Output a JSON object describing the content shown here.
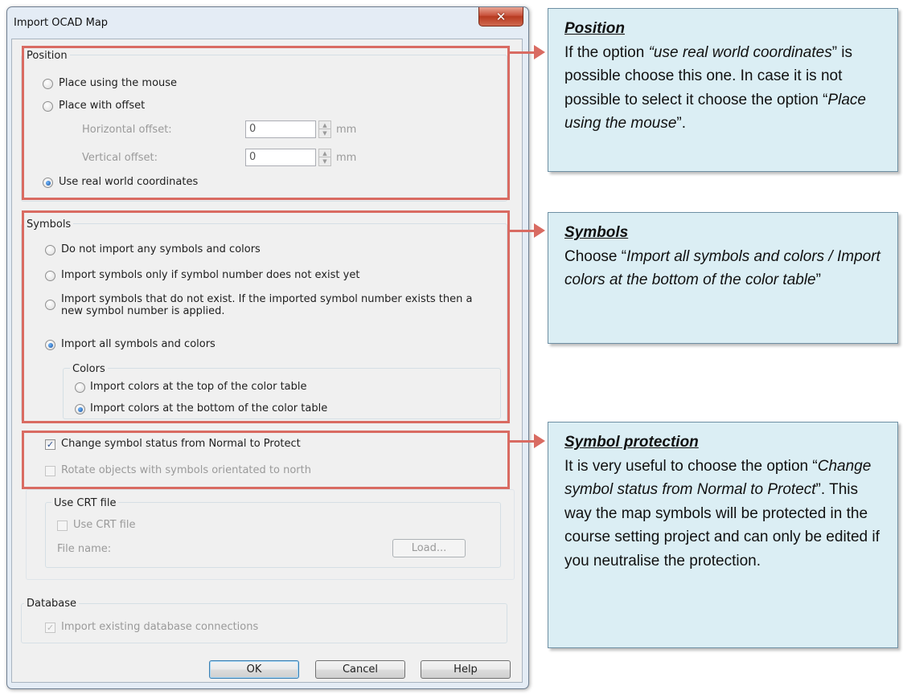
{
  "dialog": {
    "title": "Import OCAD Map",
    "close_glyph": "✕"
  },
  "position": {
    "group_label": "Position",
    "place_mouse": "Place using the mouse",
    "place_offset": "Place with offset",
    "horizontal_label": "Horizontal offset:",
    "horizontal_value": "0",
    "horizontal_unit": "mm",
    "vertical_label": "Vertical offset:",
    "vertical_value": "0",
    "vertical_unit": "mm",
    "real_world": "Use real world coordinates"
  },
  "symbols": {
    "group_label": "Symbols",
    "opt1": "Do not import any symbols and colors",
    "opt2": "Import symbols only if symbol number does not exist yet",
    "opt3": "Import symbols that do not exist. If the imported symbol number exists then a new symbol number is applied.",
    "opt4": "Import all symbols and colors",
    "colors_label": "Colors",
    "colors_top": "Import colors at the top of the color table",
    "colors_bottom": "Import colors at the bottom of the color table"
  },
  "protection": {
    "change_status": "Change symbol status from Normal to Protect",
    "rotate": "Rotate objects with symbols orientated to north"
  },
  "crt": {
    "group_label": "Use CRT file",
    "checkbox": "Use CRT file",
    "file_name_label": "File name:",
    "load_button": "Load..."
  },
  "database": {
    "group_label": "Database",
    "import_connections": "Import existing database connections"
  },
  "buttons": {
    "ok": "OK",
    "cancel": "Cancel",
    "help": "Help"
  },
  "callouts": {
    "position": {
      "title": "Position",
      "t1": "If the option ",
      "t2": "“use real world coordinates",
      "t3": "” is possible choose this one. In case it is not possible to select it choose the option “",
      "t4": "Place using the mouse",
      "t5": "”."
    },
    "symbols": {
      "title": "Symbols",
      "t1": "Choose “",
      "t2": "Import all symbols and colors / Import colors at the bottom of the color table",
      "t3": "”"
    },
    "protection": {
      "title": "Symbol protection",
      "t1": "It is very useful to choose the option “",
      "t2": "Change symbol status from Normal to Protect",
      "t3": "”. This way the map symbols will be protected in the course setting project and can only be edited if you neutralise the protection."
    }
  },
  "colors": {
    "highlight": "#d96b62",
    "callout_bg": "#dbeef4"
  }
}
